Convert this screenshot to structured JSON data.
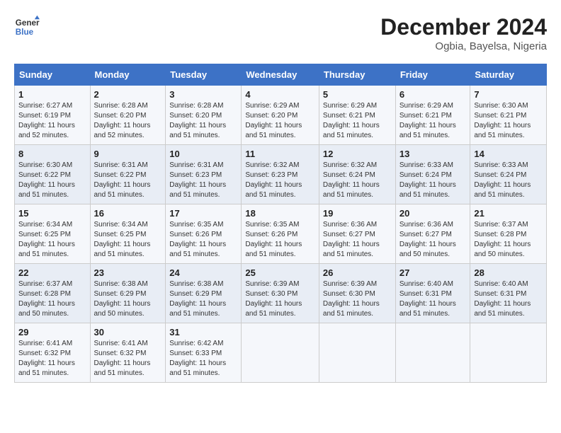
{
  "logo": {
    "line1": "General",
    "line2": "Blue"
  },
  "title": "December 2024",
  "subtitle": "Ogbia, Bayelsa, Nigeria",
  "headers": [
    "Sunday",
    "Monday",
    "Tuesday",
    "Wednesday",
    "Thursday",
    "Friday",
    "Saturday"
  ],
  "weeks": [
    [
      {
        "day": "1",
        "sunrise": "6:27 AM",
        "sunset": "6:19 PM",
        "daylight": "11 hours and 52 minutes."
      },
      {
        "day": "2",
        "sunrise": "6:28 AM",
        "sunset": "6:20 PM",
        "daylight": "11 hours and 52 minutes."
      },
      {
        "day": "3",
        "sunrise": "6:28 AM",
        "sunset": "6:20 PM",
        "daylight": "11 hours and 51 minutes."
      },
      {
        "day": "4",
        "sunrise": "6:29 AM",
        "sunset": "6:20 PM",
        "daylight": "11 hours and 51 minutes."
      },
      {
        "day": "5",
        "sunrise": "6:29 AM",
        "sunset": "6:21 PM",
        "daylight": "11 hours and 51 minutes."
      },
      {
        "day": "6",
        "sunrise": "6:29 AM",
        "sunset": "6:21 PM",
        "daylight": "11 hours and 51 minutes."
      },
      {
        "day": "7",
        "sunrise": "6:30 AM",
        "sunset": "6:21 PM",
        "daylight": "11 hours and 51 minutes."
      }
    ],
    [
      {
        "day": "8",
        "sunrise": "6:30 AM",
        "sunset": "6:22 PM",
        "daylight": "11 hours and 51 minutes."
      },
      {
        "day": "9",
        "sunrise": "6:31 AM",
        "sunset": "6:22 PM",
        "daylight": "11 hours and 51 minutes."
      },
      {
        "day": "10",
        "sunrise": "6:31 AM",
        "sunset": "6:23 PM",
        "daylight": "11 hours and 51 minutes."
      },
      {
        "day": "11",
        "sunrise": "6:32 AM",
        "sunset": "6:23 PM",
        "daylight": "11 hours and 51 minutes."
      },
      {
        "day": "12",
        "sunrise": "6:32 AM",
        "sunset": "6:24 PM",
        "daylight": "11 hours and 51 minutes."
      },
      {
        "day": "13",
        "sunrise": "6:33 AM",
        "sunset": "6:24 PM",
        "daylight": "11 hours and 51 minutes."
      },
      {
        "day": "14",
        "sunrise": "6:33 AM",
        "sunset": "6:24 PM",
        "daylight": "11 hours and 51 minutes."
      }
    ],
    [
      {
        "day": "15",
        "sunrise": "6:34 AM",
        "sunset": "6:25 PM",
        "daylight": "11 hours and 51 minutes."
      },
      {
        "day": "16",
        "sunrise": "6:34 AM",
        "sunset": "6:25 PM",
        "daylight": "11 hours and 51 minutes."
      },
      {
        "day": "17",
        "sunrise": "6:35 AM",
        "sunset": "6:26 PM",
        "daylight": "11 hours and 51 minutes."
      },
      {
        "day": "18",
        "sunrise": "6:35 AM",
        "sunset": "6:26 PM",
        "daylight": "11 hours and 51 minutes."
      },
      {
        "day": "19",
        "sunrise": "6:36 AM",
        "sunset": "6:27 PM",
        "daylight": "11 hours and 51 minutes."
      },
      {
        "day": "20",
        "sunrise": "6:36 AM",
        "sunset": "6:27 PM",
        "daylight": "11 hours and 50 minutes."
      },
      {
        "day": "21",
        "sunrise": "6:37 AM",
        "sunset": "6:28 PM",
        "daylight": "11 hours and 50 minutes."
      }
    ],
    [
      {
        "day": "22",
        "sunrise": "6:37 AM",
        "sunset": "6:28 PM",
        "daylight": "11 hours and 50 minutes."
      },
      {
        "day": "23",
        "sunrise": "6:38 AM",
        "sunset": "6:29 PM",
        "daylight": "11 hours and 50 minutes."
      },
      {
        "day": "24",
        "sunrise": "6:38 AM",
        "sunset": "6:29 PM",
        "daylight": "11 hours and 51 minutes."
      },
      {
        "day": "25",
        "sunrise": "6:39 AM",
        "sunset": "6:30 PM",
        "daylight": "11 hours and 51 minutes."
      },
      {
        "day": "26",
        "sunrise": "6:39 AM",
        "sunset": "6:30 PM",
        "daylight": "11 hours and 51 minutes."
      },
      {
        "day": "27",
        "sunrise": "6:40 AM",
        "sunset": "6:31 PM",
        "daylight": "11 hours and 51 minutes."
      },
      {
        "day": "28",
        "sunrise": "6:40 AM",
        "sunset": "6:31 PM",
        "daylight": "11 hours and 51 minutes."
      }
    ],
    [
      {
        "day": "29",
        "sunrise": "6:41 AM",
        "sunset": "6:32 PM",
        "daylight": "11 hours and 51 minutes."
      },
      {
        "day": "30",
        "sunrise": "6:41 AM",
        "sunset": "6:32 PM",
        "daylight": "11 hours and 51 minutes."
      },
      {
        "day": "31",
        "sunrise": "6:42 AM",
        "sunset": "6:33 PM",
        "daylight": "11 hours and 51 minutes."
      },
      null,
      null,
      null,
      null
    ]
  ],
  "labels": {
    "sunrise": "Sunrise: ",
    "sunset": "Sunset: ",
    "daylight": "Daylight: "
  }
}
